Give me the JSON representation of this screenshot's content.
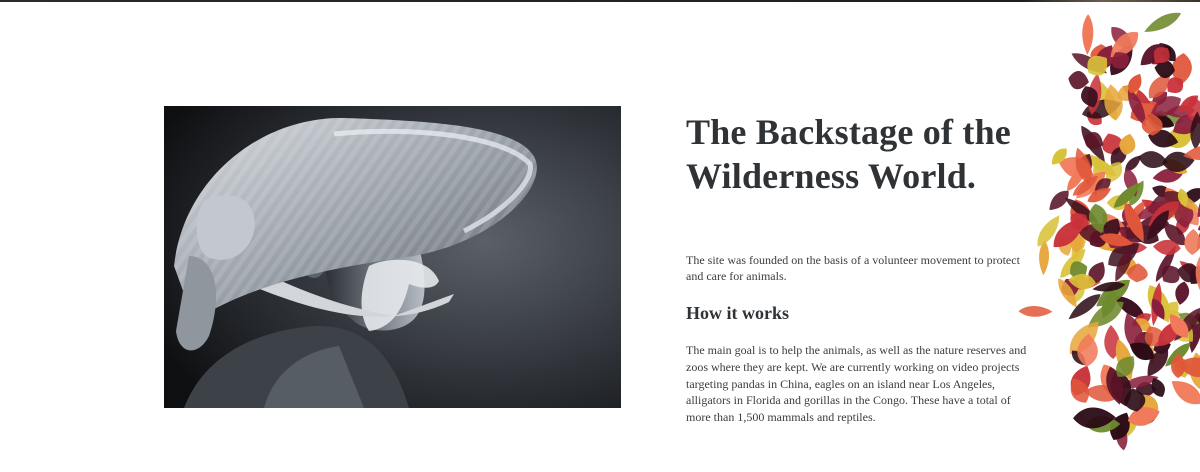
{
  "hero": {
    "title_line1": "The Backstage of the",
    "title_line2": "Wilderness World.",
    "intro": "The site was founded on the basis of a volunteer movement to protect and care for animals.",
    "subheading": "How it works",
    "body": "The main goal is to help the animals, as well as the nature reserves and zoos where they are kept. We are currently working on video projects targeting pandas in China, eagles on an island near Los Angeles, alligators in Florida and gorillas in the Congo. These have a total of more than 1,500 mammals and reptiles."
  },
  "media": {
    "photo_subject": "portrait-photo",
    "decoration": "foliage-decoration"
  },
  "colors": {
    "text": "#2f3336",
    "background": "#ffffff",
    "leaf_red": "#c8323a",
    "leaf_dark": "#3b0f1e",
    "leaf_yellow": "#d9c23a",
    "leaf_green": "#6f8a2e"
  }
}
